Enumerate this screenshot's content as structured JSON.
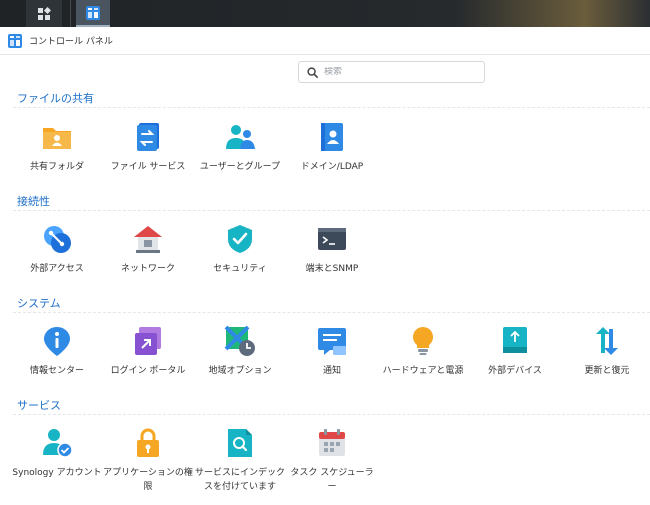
{
  "window": {
    "title": "コントロール パネル"
  },
  "search": {
    "placeholder": "検索",
    "value": ""
  },
  "sections": [
    {
      "title": "ファイルの共有",
      "items": [
        {
          "label": "共有フォルダ",
          "icon": "shared-folder-icon"
        },
        {
          "label": "ファイル サービス",
          "icon": "file-services-icon"
        },
        {
          "label": "ユーザーとグループ",
          "icon": "users-groups-icon"
        },
        {
          "label": "ドメイン/LDAP",
          "icon": "domain-ldap-icon"
        }
      ]
    },
    {
      "title": "接続性",
      "items": [
        {
          "label": "外部アクセス",
          "icon": "external-access-icon"
        },
        {
          "label": "ネットワーク",
          "icon": "network-icon"
        },
        {
          "label": "セキュリティ",
          "icon": "security-shield-icon"
        },
        {
          "label": "端末とSNMP",
          "icon": "terminal-icon"
        }
      ]
    },
    {
      "title": "システム",
      "items": [
        {
          "label": "情報センター",
          "icon": "info-center-icon"
        },
        {
          "label": "ログイン ポータル",
          "icon": "login-portal-icon"
        },
        {
          "label": "地域オプション",
          "icon": "regional-options-icon"
        },
        {
          "label": "通知",
          "icon": "notification-icon"
        },
        {
          "label": "ハードウェアと電源",
          "icon": "hardware-power-icon"
        },
        {
          "label": "外部デバイス",
          "icon": "external-devices-icon"
        },
        {
          "label": "更新と復元",
          "icon": "update-restore-icon"
        }
      ]
    },
    {
      "title": "サービス",
      "items": [
        {
          "label": "Synology アカウント",
          "icon": "synology-account-icon"
        },
        {
          "label": "アプリケーションの権限",
          "icon": "app-privileges-icon"
        },
        {
          "label": "サービスにインデックスを付けています",
          "icon": "indexing-service-icon"
        },
        {
          "label": "タスク スケジューラー",
          "icon": "task-scheduler-icon"
        }
      ]
    }
  ],
  "colors": {
    "accent": "#1e6fc9",
    "orange": "#f5a623",
    "blue": "#2f8ae5",
    "teal": "#16b4c4"
  }
}
